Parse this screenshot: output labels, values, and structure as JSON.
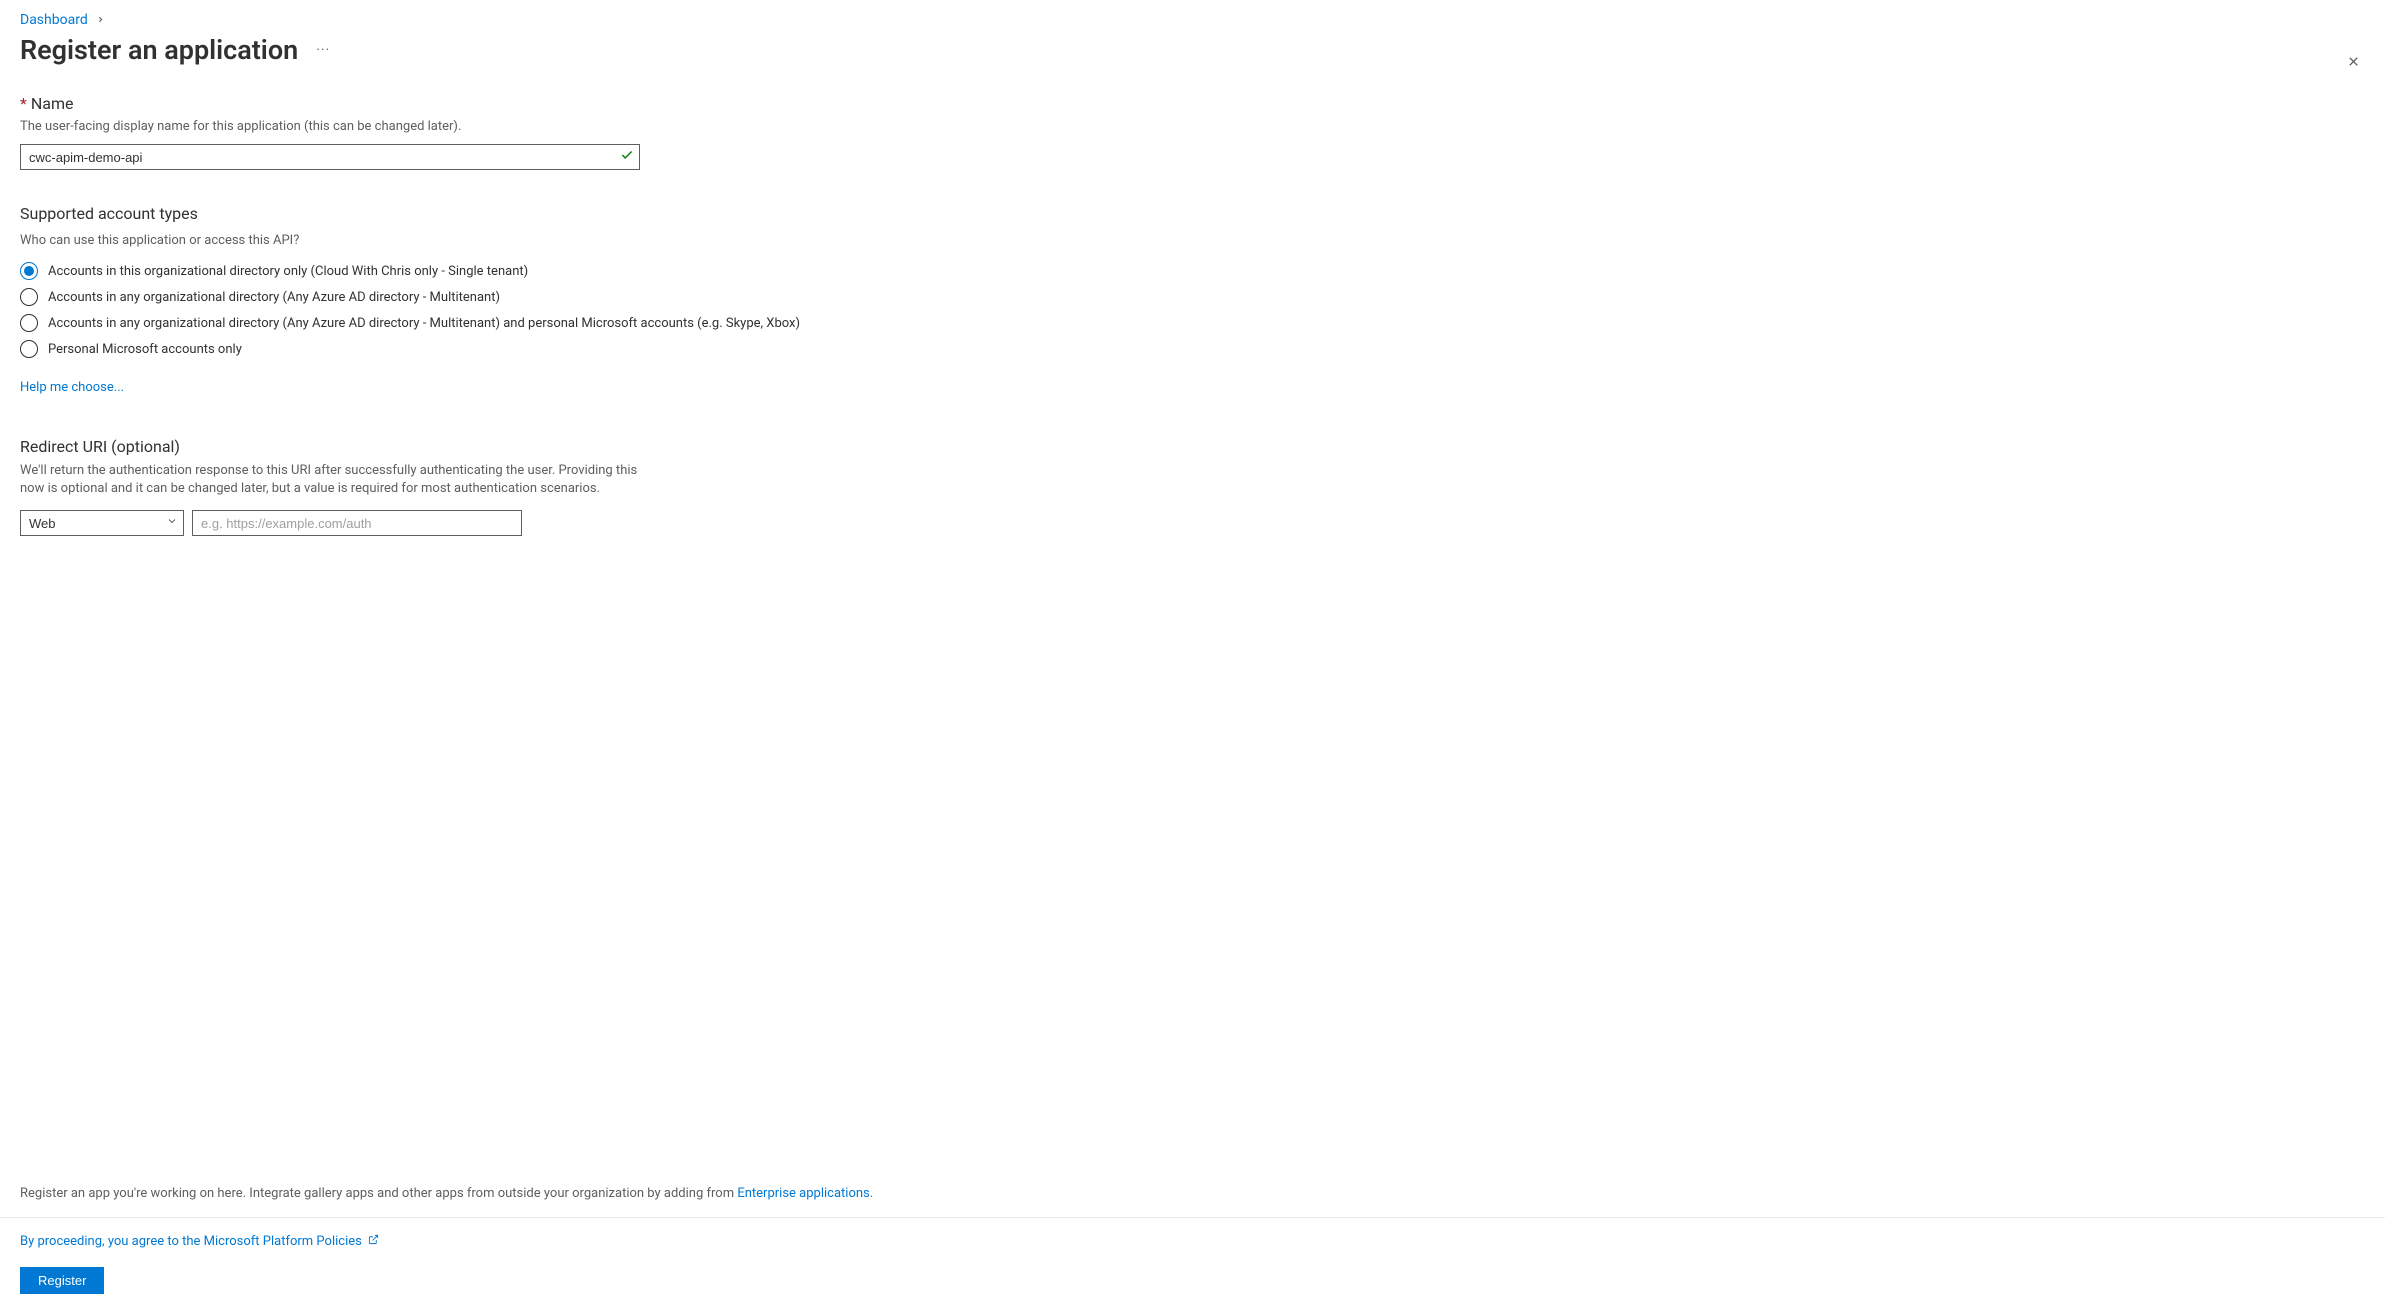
{
  "breadcrumb": {
    "parent": "Dashboard"
  },
  "page": {
    "title": "Register an application"
  },
  "name": {
    "label": "Name",
    "helper": "The user-facing display name for this application (this can be changed later).",
    "value": "cwc-apim-demo-api"
  },
  "accountTypes": {
    "heading": "Supported account types",
    "question": "Who can use this application or access this API?",
    "options": [
      "Accounts in this organizational directory only (Cloud With Chris only - Single tenant)",
      "Accounts in any organizational directory (Any Azure AD directory - Multitenant)",
      "Accounts in any organizational directory (Any Azure AD directory - Multitenant) and personal Microsoft accounts (e.g. Skype, Xbox)",
      "Personal Microsoft accounts only"
    ],
    "helpLink": "Help me choose..."
  },
  "redirect": {
    "heading": "Redirect URI (optional)",
    "desc": "We'll return the authentication response to this URI after successfully authenticating the user. Providing this now is optional and it can be changed later, but a value is required for most authentication scenarios.",
    "platformSelected": "Web",
    "uriPlaceholder": "e.g. https://example.com/auth"
  },
  "footer": {
    "noteBefore": "Register an app you're working on here. Integrate gallery apps and other apps from outside your organization by adding from ",
    "noteLink": "Enterprise applications",
    "noteAfter": ".",
    "policyText": "By proceeding, you agree to the Microsoft Platform Policies",
    "registerLabel": "Register"
  }
}
